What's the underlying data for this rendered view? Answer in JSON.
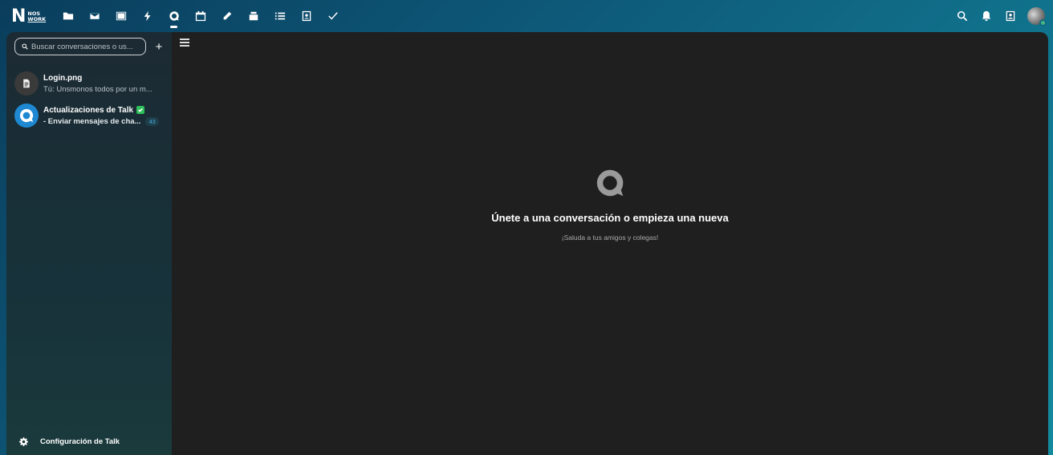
{
  "header": {
    "logo": {
      "letter": "N",
      "line1": "NOS",
      "line2": "WORK"
    },
    "apps": [
      {
        "name": "files",
        "icon": "folder-icon",
        "active": false
      },
      {
        "name": "mail",
        "icon": "mail-icon",
        "active": false
      },
      {
        "name": "photos",
        "icon": "image-icon",
        "active": false
      },
      {
        "name": "activity",
        "icon": "lightning-icon",
        "active": false
      },
      {
        "name": "talk",
        "icon": "talk-icon",
        "active": true
      },
      {
        "name": "calendar",
        "icon": "calendar-icon",
        "active": false
      },
      {
        "name": "notes",
        "icon": "pencil-icon",
        "active": false
      },
      {
        "name": "deck",
        "icon": "deck-icon",
        "active": false
      },
      {
        "name": "tasks",
        "icon": "list-icon",
        "active": false
      },
      {
        "name": "contacts",
        "icon": "contacts-icon",
        "active": false
      },
      {
        "name": "checks",
        "icon": "check-icon",
        "active": false
      }
    ],
    "right_icons": [
      "search-icon",
      "bell-icon",
      "contacts-menu-icon"
    ]
  },
  "sidebar": {
    "search_placeholder": "Buscar conversaciones o us...",
    "add_label": "+",
    "conversations": [
      {
        "title": "Login.png",
        "subtitle": "Tú: Unsmonos todos por un m...",
        "avatar": "file-icon"
      },
      {
        "title": "Actualizaciones de Talk",
        "subtitle": "- Enviar mensajes de cha...",
        "avatar": "talk-logo-icon",
        "verified": true,
        "unread": "43"
      }
    ],
    "settings_label": "Configuración de Talk"
  },
  "main": {
    "empty_title": "Únete a una conversación o empieza una nueva",
    "empty_subtitle": "¡Saluda a tus amigos y colegas!"
  },
  "colors": {
    "header_gradient_start": "#0a3d5c",
    "header_gradient_end": "#138a9e",
    "main_bg": "#1f1f1f",
    "verified": "#2fbf5a",
    "status_online": "#49b382",
    "talk_blue": "#1e88d2"
  }
}
